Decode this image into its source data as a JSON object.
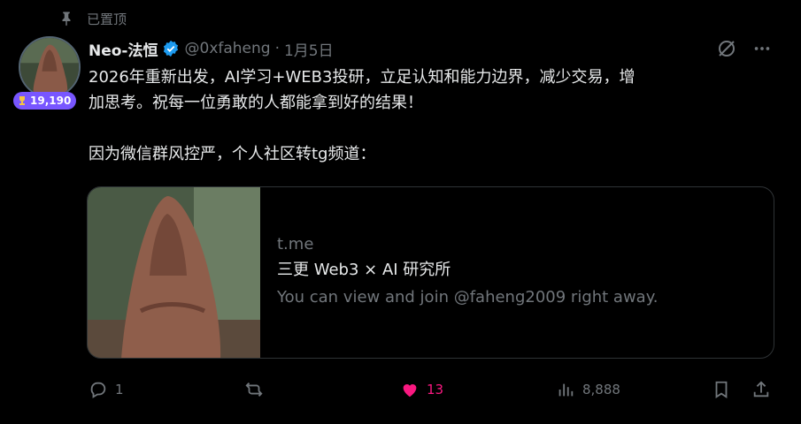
{
  "pinned": {
    "label": "已置顶",
    "icon": "pin-icon"
  },
  "user": {
    "name": "Neo-法恒",
    "handle": "@0xfaheng",
    "separator": "·",
    "date": "1月5日",
    "badge_count": "19,190",
    "verified_color": "#1d9bf0"
  },
  "tweet": {
    "line1": "2026年重新出发，AI学习+WEB3投研，立足认知和能力边界，减少交易，增",
    "line2": "加思考。祝每一位勇敢的人都能拿到好的结果！",
    "line3": "因为微信群风控严，个人社区转tg频道："
  },
  "card": {
    "domain": "t.me",
    "title": "三更 Web3 × AI 研究所",
    "description": "You can view and join @faheng2009 right away."
  },
  "actions": {
    "reply_count": "1",
    "retweet_count": "",
    "like_count": "13",
    "views_count": "8,888"
  },
  "colors": {
    "accent": "#1d9bf0",
    "like": "#f91880",
    "muted": "#71767b",
    "badge": "#7856ff"
  }
}
